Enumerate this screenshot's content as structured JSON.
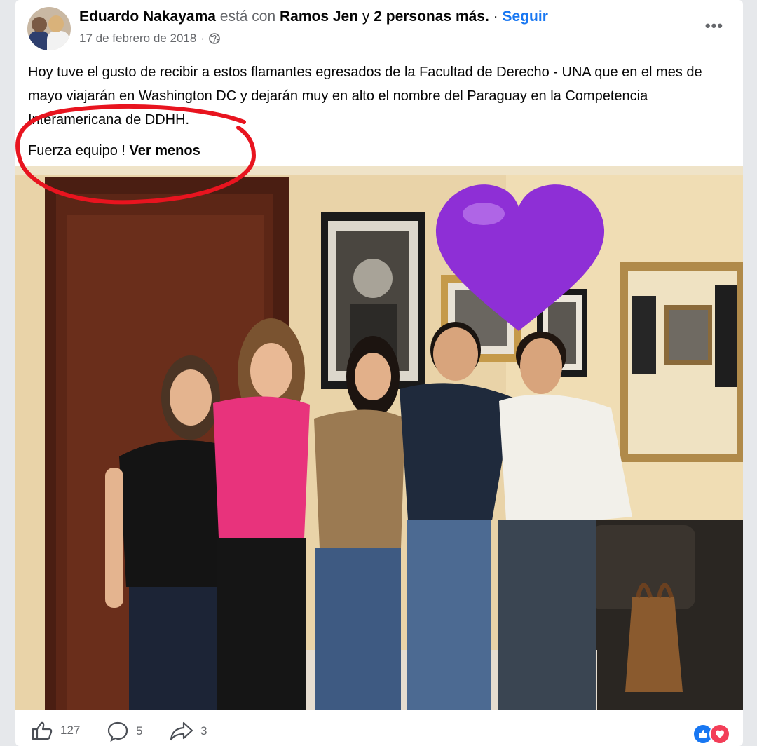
{
  "post": {
    "author": "Eduardo Nakayama",
    "with_text": "está con",
    "tagged": "Ramos Jen",
    "and_text": "y",
    "others": "2 personas más.",
    "separator": "·",
    "follow_label": "Seguir",
    "date": "17 de febrero de 2018",
    "date_separator": "·",
    "more_label": "•••",
    "body_paragraph_1": "Hoy tuve el gusto de recibir a estos flamantes egresados de la Facultad de Derecho - UNA que en el mes de mayo viajarán en Washington DC y dejarán muy en alto el nombre del Paraguay en la Competencia Interamericana de DDHH.",
    "body_paragraph_2": "Fuerza equipo !",
    "see_less_label": "Ver menos"
  },
  "stats": {
    "likes": "127",
    "comments": "5",
    "shares": "3"
  },
  "colors": {
    "accent": "#1877f2",
    "annotation": "#e8141f",
    "heart": "#8e2fd6",
    "love_reaction": "#f33e58"
  },
  "icons": {
    "privacy": "globe-icon",
    "like": "thumbs-up-icon",
    "comment": "comment-icon",
    "share": "share-icon",
    "menu": "more-options-icon"
  }
}
